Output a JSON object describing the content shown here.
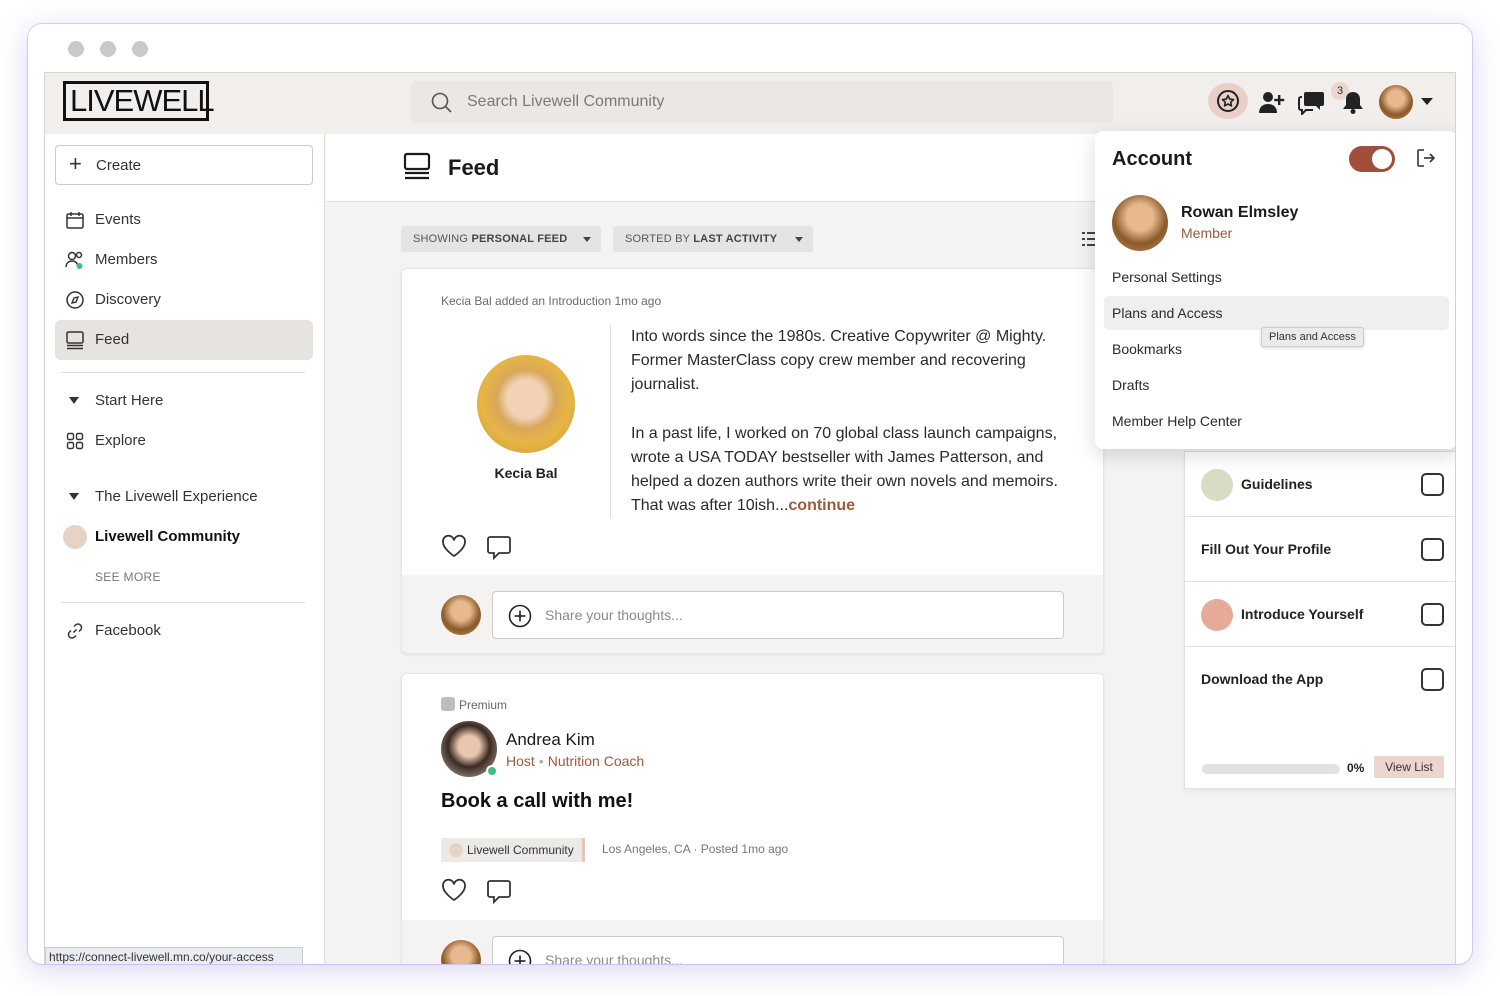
{
  "brand": {
    "logo_text": "LIVEWELL",
    "accent": "#9c5b3c",
    "toggle_color": "#a0503a"
  },
  "search": {
    "placeholder": "Search Livewell Community"
  },
  "topbar": {
    "icons": [
      "star-badge-icon",
      "add-user-icon",
      "chat-icon",
      "bell-icon"
    ],
    "notification_count": "3"
  },
  "sidebar": {
    "create_label": "Create",
    "items": [
      {
        "label": "Events",
        "icon": "calendar-icon"
      },
      {
        "label": "Members",
        "icon": "members-icon"
      },
      {
        "label": "Discovery",
        "icon": "compass-icon"
      },
      {
        "label": "Feed",
        "icon": "feed-icon",
        "active": true
      }
    ],
    "section_start": "Start Here",
    "explore": "Explore",
    "section_experience": "The Livewell Experience",
    "community": "Livewell Community",
    "see_more": "SEE MORE",
    "facebook": "Facebook"
  },
  "status_url": "https://connect-livewell.mn.co/your-access",
  "feed": {
    "title": "Feed",
    "filter_showing_prefix": "SHOWING",
    "filter_showing_value": "PERSONAL FEED",
    "filter_sort_prefix": "SORTED BY",
    "filter_sort_value": "LAST ACTIVITY",
    "post1": {
      "meta": "Kecia Bal added an Introduction 1mo ago",
      "author": "Kecia Bal",
      "para1": "Into words since the 1980s. Creative Copywriter @ Mighty. Former MasterClass copy crew member and recovering journalist.",
      "para2": "In a past life, I worked on 70 global class launch campaigns, wrote a USA TODAY bestseller with James Patterson, and helped a dozen authors write their own novels and memoirs. That was after 10ish...",
      "continue": "continue",
      "composer_placeholder": "Share your thoughts..."
    },
    "post2": {
      "badge": "Premium",
      "host_name": "Andrea Kim",
      "host_role": "Host",
      "host_title": "Nutrition Coach",
      "bullet": "•",
      "title": "Book a call with me!",
      "tag": "Livewell Community",
      "meta": "Los Angeles, CA ·  Posted 1mo ago",
      "composer_placeholder": "Share your thoughts..."
    }
  },
  "checklist": {
    "items": [
      {
        "label": "Guidelines",
        "checked": false
      },
      {
        "label": "Fill Out Your Profile",
        "checked": false
      },
      {
        "label": "Introduce Yourself",
        "checked": false
      },
      {
        "label": "Download the App",
        "checked": false
      }
    ],
    "progress": 0,
    "progress_label": "0%",
    "view_list": "View List"
  },
  "account": {
    "title": "Account",
    "name": "Rowan Elmsley",
    "role": "Member",
    "items": [
      "Personal Settings",
      "Plans and Access",
      "Bookmarks",
      "Drafts",
      "Member Help Center"
    ],
    "tooltip": "Plans and Access"
  }
}
